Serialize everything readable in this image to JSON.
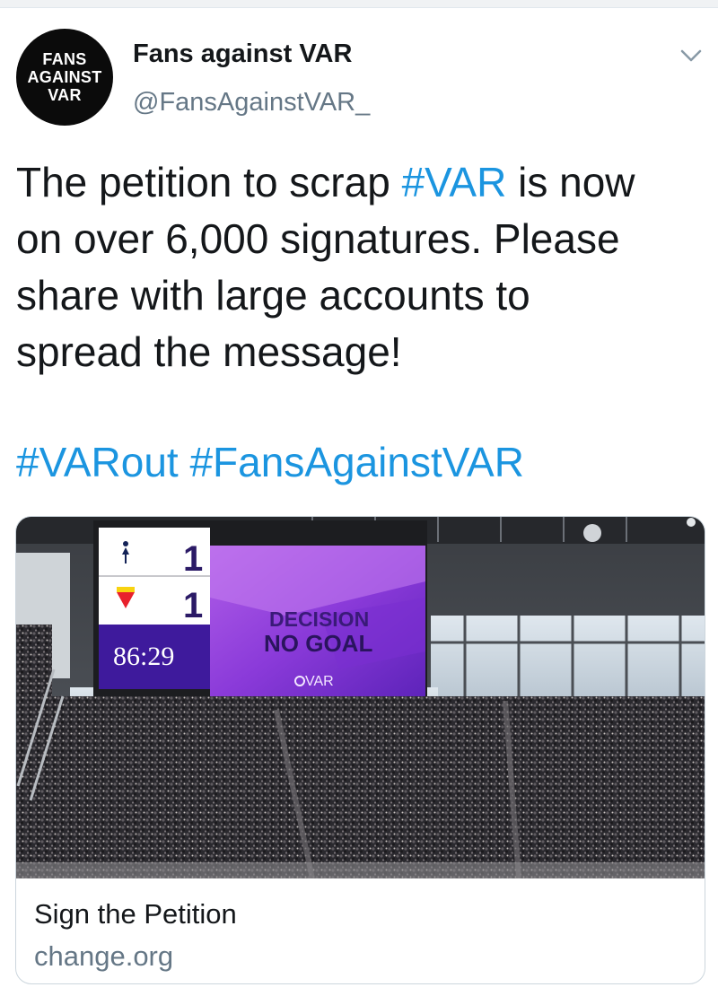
{
  "tweet": {
    "author": {
      "display_name": "Fans against VAR",
      "handle": "@FansAgainstVAR_",
      "avatar_lines": [
        "FANS",
        "AGAINST",
        "VAR"
      ]
    },
    "text_lines": [
      {
        "pre": "The petition to scrap ",
        "tag": "#VAR",
        "post": " is now"
      },
      {
        "pre": "on over 6,000 signatures. Please",
        "tag": "",
        "post": ""
      },
      {
        "pre": "share with large accounts to",
        "tag": "",
        "post": ""
      },
      {
        "pre": "spread the message!",
        "tag": "",
        "post": ""
      }
    ],
    "hashtags": "#VARout #FansAgainstVAR",
    "menu_icon": "chevron-down-icon"
  },
  "card": {
    "title": "Sign the Petition",
    "domain": "change.org",
    "image": {
      "scoreboard": {
        "home_score": "1",
        "away_score": "1",
        "clock": "86:29",
        "decision_title": "DECISION",
        "decision_result": "NO GOAL",
        "var_logo": "VAR"
      }
    }
  },
  "colors": {
    "link": "#1b95e0",
    "secondary_text": "#657786",
    "primary_text": "#14171a",
    "border": "#ccd6dd",
    "screen_purple": "#8a3ad9"
  }
}
